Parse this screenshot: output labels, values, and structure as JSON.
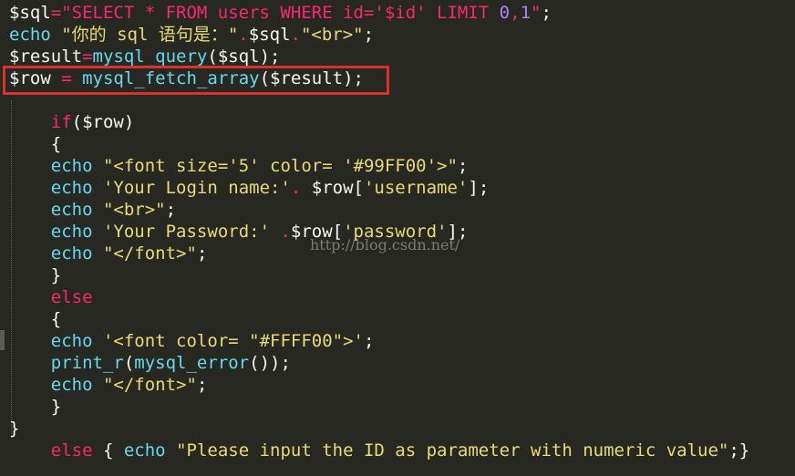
{
  "colors": {
    "background": "#272822",
    "text": "#f8f8f2",
    "keyword": "#f92672",
    "string": "#e6db74",
    "builtin": "#66d9ef",
    "number": "#ae81ff",
    "highlight_border": "#d9332b"
  },
  "watermark": "http://blog.csdn.net/",
  "lines": [
    [
      [
        "$sql",
        "text"
      ],
      [
        "=",
        "keyword"
      ],
      [
        "\"SELECT * FROM users WHERE id='$id' LIMIT ",
        "keyword"
      ],
      [
        "0",
        "number"
      ],
      [
        ",",
        "keyword"
      ],
      [
        "1",
        "number"
      ],
      [
        "\"",
        "keyword"
      ],
      [
        ";",
        "text"
      ]
    ],
    [
      [
        "echo",
        "builtin"
      ],
      [
        " ",
        "text"
      ],
      [
        "\"你的 sql 语句是：\"",
        "string"
      ],
      [
        ".",
        "keyword"
      ],
      [
        "$sql",
        "text"
      ],
      [
        ".",
        "keyword"
      ],
      [
        "\"<br>\"",
        "string"
      ],
      [
        ";",
        "text"
      ]
    ],
    [
      [
        "$result",
        "text"
      ],
      [
        "=",
        "keyword"
      ],
      [
        "mysql_query",
        "builtin"
      ],
      [
        "($sql);",
        "text"
      ]
    ],
    [
      [
        "$row ",
        "text"
      ],
      [
        "=",
        "keyword"
      ],
      [
        " ",
        "text"
      ],
      [
        "mysql_fetch_array",
        "builtin"
      ],
      [
        "($result);",
        "text"
      ]
    ],
    [],
    [
      [
        "    ",
        "text"
      ],
      [
        "if",
        "keyword"
      ],
      [
        "($row)",
        "text"
      ]
    ],
    [
      [
        "    {",
        "text"
      ]
    ],
    [
      [
        "    ",
        "text"
      ],
      [
        "echo",
        "builtin"
      ],
      [
        " ",
        "text"
      ],
      [
        "\"<font size='5' color= '#99FF00'>\"",
        "string"
      ],
      [
        ";",
        "text"
      ]
    ],
    [
      [
        "    ",
        "text"
      ],
      [
        "echo",
        "builtin"
      ],
      [
        " ",
        "text"
      ],
      [
        "'Your Login name:'",
        "string"
      ],
      [
        ". ",
        "keyword"
      ],
      [
        "$row[",
        "text"
      ],
      [
        "'username'",
        "string"
      ],
      [
        "];",
        "text"
      ]
    ],
    [
      [
        "    ",
        "text"
      ],
      [
        "echo",
        "builtin"
      ],
      [
        " ",
        "text"
      ],
      [
        "\"<br>\"",
        "string"
      ],
      [
        ";",
        "text"
      ]
    ],
    [
      [
        "    ",
        "text"
      ],
      [
        "echo",
        "builtin"
      ],
      [
        " ",
        "text"
      ],
      [
        "'Your Password:'",
        "string"
      ],
      [
        " .",
        "keyword"
      ],
      [
        "$row[",
        "text"
      ],
      [
        "'password'",
        "string"
      ],
      [
        "];",
        "text"
      ]
    ],
    [
      [
        "    ",
        "text"
      ],
      [
        "echo",
        "builtin"
      ],
      [
        " ",
        "text"
      ],
      [
        "\"</font>\"",
        "string"
      ],
      [
        ";",
        "text"
      ]
    ],
    [
      [
        "    }",
        "text"
      ]
    ],
    [
      [
        "    ",
        "text"
      ],
      [
        "else",
        "keyword"
      ]
    ],
    [
      [
        "    {",
        "text"
      ]
    ],
    [
      [
        "    ",
        "text"
      ],
      [
        "echo",
        "builtin"
      ],
      [
        " ",
        "text"
      ],
      [
        "'<font color= \"#FFFF00\">'",
        "string"
      ],
      [
        ";",
        "text"
      ]
    ],
    [
      [
        "    ",
        "text"
      ],
      [
        "print_r",
        "builtin"
      ],
      [
        "(",
        "text"
      ],
      [
        "mysql_error",
        "builtin"
      ],
      [
        "());",
        "text"
      ]
    ],
    [
      [
        "    ",
        "text"
      ],
      [
        "echo",
        "builtin"
      ],
      [
        " ",
        "text"
      ],
      [
        "\"</font>\"",
        "string"
      ],
      [
        ";",
        "text"
      ]
    ],
    [
      [
        "    }",
        "text"
      ]
    ],
    [
      [
        "}",
        "text"
      ]
    ],
    [
      [
        "    ",
        "text"
      ],
      [
        "else",
        "keyword"
      ],
      [
        " { ",
        "text"
      ],
      [
        "echo",
        "builtin"
      ],
      [
        " ",
        "text"
      ],
      [
        "\"Please input the ID as parameter with numeric value\"",
        "string"
      ],
      [
        ";}",
        "text"
      ]
    ]
  ]
}
